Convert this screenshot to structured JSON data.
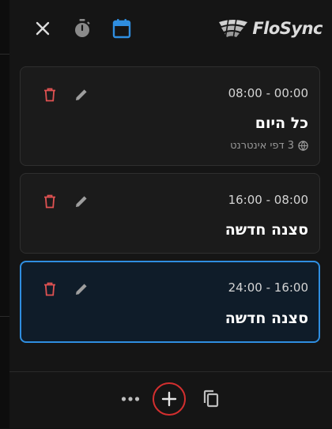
{
  "header": {
    "close_icon": "close-icon",
    "timer_icon": "timer-icon",
    "calendar_icon": "calendar-icon",
    "logo_text": "FloSync",
    "accent": "#2f8ee0"
  },
  "scenes": [
    {
      "time": "08:00 - 00:00",
      "title": "כל היום",
      "meta": "3 דפי אינטרנט",
      "active": false
    },
    {
      "time": "16:00 - 08:00",
      "title": "סצנה חדשה",
      "meta": "",
      "active": false
    },
    {
      "time": "24:00 - 16:00",
      "title": "סצנה חדשה",
      "meta": "",
      "active": true
    }
  ],
  "colors": {
    "delete": "#e05252",
    "edit": "#9e9e9e",
    "highlight": "#d32f2f"
  },
  "footer": {
    "more_icon": "more-horizontal-icon",
    "add_icon": "add-icon",
    "copy_icon": "copy-icon"
  }
}
